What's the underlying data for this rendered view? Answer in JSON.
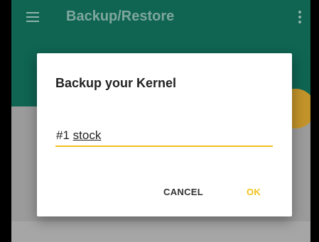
{
  "appbar": {
    "title": "Backup/Restore",
    "menu_icon": "hamburger-menu-icon",
    "overflow_icon": "more-vert-icon"
  },
  "fab": {
    "icon": "fab"
  },
  "dialog": {
    "title": "Backup your Kernel",
    "input": {
      "prefix": "#1",
      "word": "stock",
      "value": "#1 stock"
    },
    "cancel_label": "CANCEL",
    "ok_label": "OK"
  },
  "colors": {
    "appbar": "#0f6452",
    "accent": "#f2c21b",
    "scrim_background": "#9b9b9b"
  }
}
